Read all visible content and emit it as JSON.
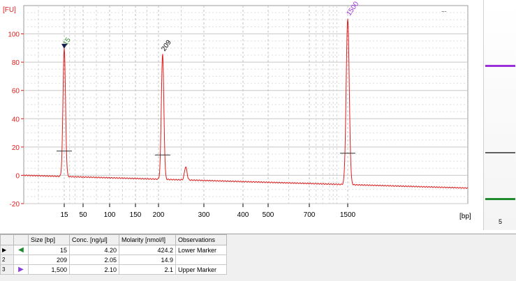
{
  "chart_data": {
    "type": "line",
    "y_unit_label": "[FU]",
    "x_unit_label": "[bp]",
    "top_right_label": "...",
    "ylim": [
      -20,
      120
    ],
    "y_ticks": [
      "100",
      "80",
      "60",
      "40",
      "20",
      "0",
      "-20"
    ],
    "x_ticks": [
      "15",
      "50",
      "100",
      "150",
      "200",
      "300",
      "400",
      "500",
      "700",
      "1500"
    ],
    "grid": true,
    "series": [
      {
        "color": "#e01b1b",
        "peaks": [
          {
            "size_bp": 15,
            "fu": 90,
            "label": "15",
            "label_color": "#2e8b2e"
          },
          {
            "size_bp": 209,
            "fu": 86,
            "label": "209",
            "label_color": "#000000"
          },
          {
            "size_bp": 260,
            "fu": 6
          },
          {
            "size_bp": 1500,
            "fu": 111,
            "label": "1500",
            "label_color": "#9b30d9"
          }
        ],
        "baseline_start": 0,
        "baseline_end": -9
      }
    ],
    "lower_marker_color": "#1a1a50"
  },
  "lane": {
    "label": "5",
    "bands": [
      {
        "name": "upper-marker-band",
        "color": "#9b30d9"
      },
      {
        "name": "sample-band",
        "color": "#606060"
      },
      {
        "name": "lower-marker-band",
        "color": "#1f8a2e"
      }
    ]
  },
  "table": {
    "headers": [
      "Size [bp]",
      "Conc. [ng/µl]",
      "Molarity [nmol/l]",
      "Observations"
    ],
    "rows": [
      {
        "num": "",
        "marker_color": "#1f8a2e",
        "marker_dir": "left",
        "size": "15",
        "conc": "4.20",
        "molarity": "424.2",
        "observation": "Lower Marker",
        "current": true
      },
      {
        "num": "2",
        "marker_color": "",
        "marker_dir": "",
        "size": "209",
        "conc": "2.05",
        "molarity": "14.9",
        "observation": ""
      },
      {
        "num": "3",
        "marker_color": "#8a3fd9",
        "marker_dir": "right",
        "size": "1,500",
        "conc": "2.10",
        "molarity": "2.1",
        "observation": "Upper Marker"
      }
    ]
  }
}
